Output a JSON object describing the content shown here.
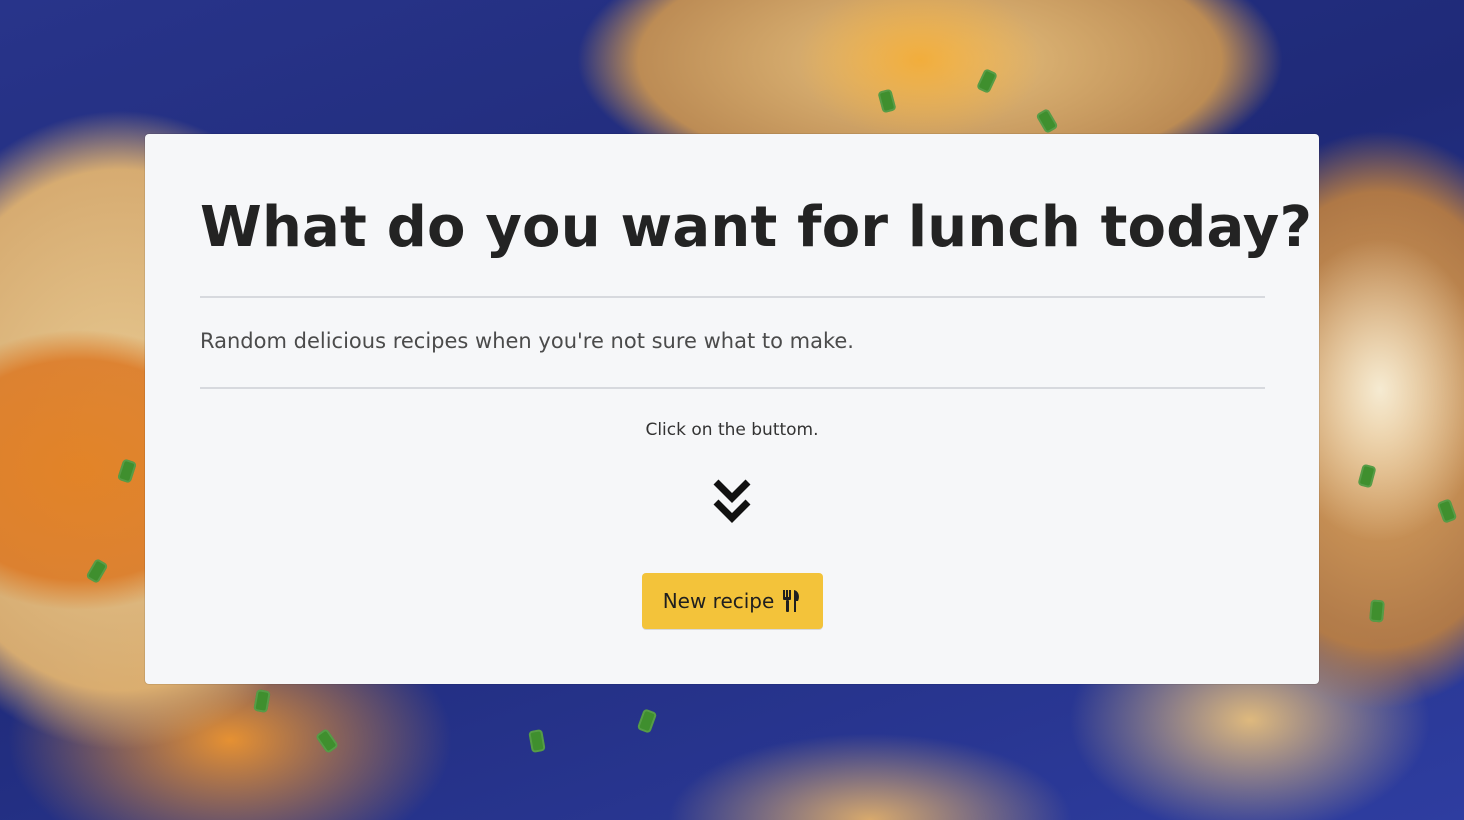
{
  "hero": {
    "title": "What do you want for lunch today?",
    "subtitle": "Random delicious recipes when you're not sure what to make.",
    "hint": "Click on the buttom.",
    "button_label": "New recipe",
    "button_icon": "utensils-icon",
    "arrow_icon": "double-chevron-down-icon"
  },
  "colors": {
    "panel_bg": "#f6f7f9",
    "button_bg": "#f3c33a",
    "title_text": "#232323",
    "background_blue": "#2b3a8f"
  }
}
